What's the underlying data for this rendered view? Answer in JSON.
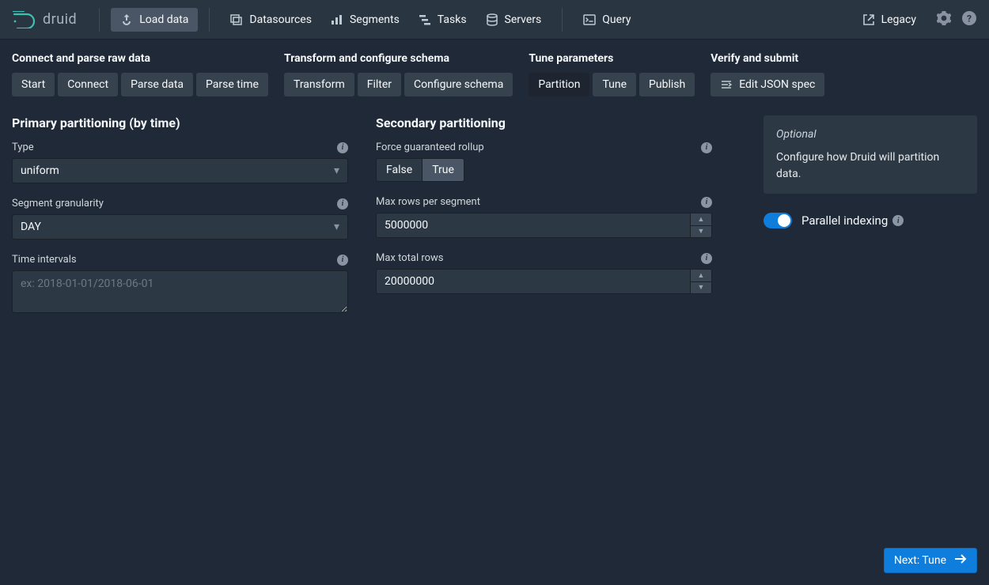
{
  "nav": {
    "brand": "druid",
    "items": [
      {
        "label": "Load data",
        "active": true,
        "icon": "upload"
      },
      {
        "label": "Datasources",
        "icon": "stack"
      },
      {
        "label": "Segments",
        "icon": "chart"
      },
      {
        "label": "Tasks",
        "icon": "gantt"
      },
      {
        "label": "Servers",
        "icon": "database"
      },
      {
        "label": "Query",
        "icon": "console"
      }
    ],
    "legacy": "Legacy"
  },
  "steps": {
    "group1": {
      "label": "Connect and parse raw data",
      "pills": [
        "Start",
        "Connect",
        "Parse data",
        "Parse time"
      ]
    },
    "group2": {
      "label": "Transform and configure schema",
      "pills": [
        "Transform",
        "Filter",
        "Configure schema"
      ]
    },
    "group3": {
      "label": "Tune parameters",
      "pills": [
        "Partition",
        "Tune",
        "Publish"
      ],
      "active": "Partition"
    },
    "group4": {
      "label": "Verify and submit",
      "pills": [
        "Edit JSON spec"
      ],
      "iconPill": true
    }
  },
  "primary": {
    "heading": "Primary partitioning (by time)",
    "type_label": "Type",
    "type_value": "uniform",
    "seg_label": "Segment granularity",
    "seg_value": "DAY",
    "intervals_label": "Time intervals",
    "intervals_placeholder": "ex: 2018-01-01/2018-06-01"
  },
  "secondary": {
    "heading": "Secondary partitioning",
    "rollup_label": "Force guaranteed rollup",
    "rollup_false": "False",
    "rollup_true": "True",
    "maxrows_label": "Max rows per segment",
    "maxrows_value": "5000000",
    "maxtotal_label": "Max total rows",
    "maxtotal_value": "20000000"
  },
  "side": {
    "optional": "Optional",
    "text": "Configure how Druid will partition data.",
    "parallel_label": "Parallel indexing"
  },
  "next": "Next: Tune"
}
